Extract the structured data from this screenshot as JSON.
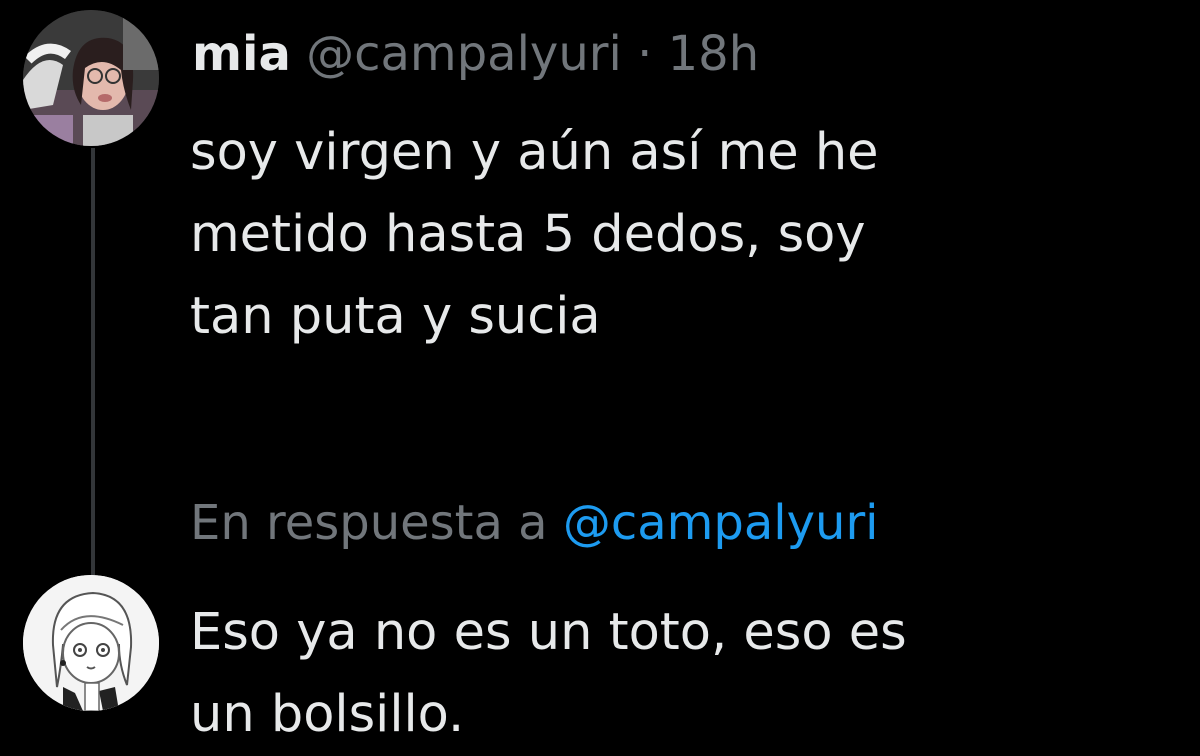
{
  "post": {
    "author_name": "mia",
    "author_handle": "@campalyuri",
    "separator": "·",
    "timestamp": "18h",
    "text_lines": [
      "soy virgen y aún así me he",
      "metido hasta 5 dedos, soy",
      "tan puta y sucia"
    ]
  },
  "reply": {
    "context_prefix": "En respuesta a",
    "context_mention": "@campalyuri",
    "text_lines": [
      "Eso ya no es un toto, eso es",
      "un bolsillo."
    ]
  },
  "colors": {
    "background": "#000000",
    "primary_text": "#e7e9ea",
    "secondary_text": "#71767b",
    "mention": "#1d9bf0",
    "thread_line": "#333639"
  }
}
